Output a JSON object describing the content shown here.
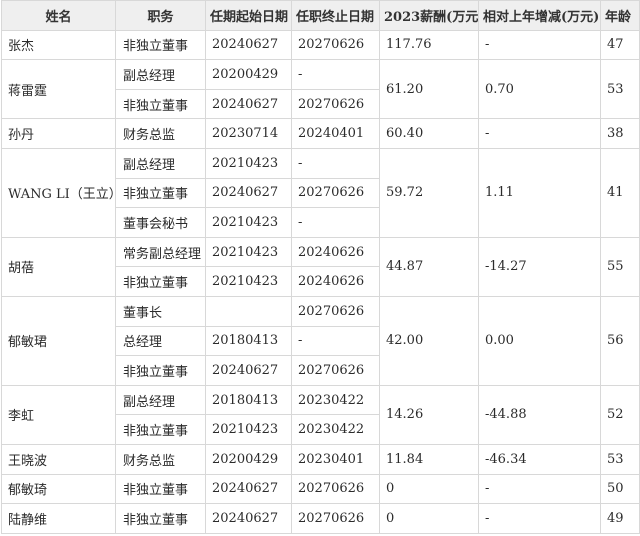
{
  "headers": [
    "姓名",
    "职务",
    "任期起始日期",
    "任职终止日期",
    "2023薪酬(万元)",
    "相对上年增减(万元)",
    "年龄"
  ],
  "people": [
    {
      "name": "张杰",
      "pay": "117.76",
      "change": "-",
      "age": "47",
      "roles": [
        {
          "title": "非独立董事",
          "start": "20240627",
          "end": "20270626"
        }
      ]
    },
    {
      "name": "蒋雷霆",
      "pay": "61.20",
      "change": "0.70",
      "age": "53",
      "roles": [
        {
          "title": "副总经理",
          "start": "20200429",
          "end": "-"
        },
        {
          "title": "非独立董事",
          "start": "20240627",
          "end": "20270626"
        }
      ]
    },
    {
      "name": "孙丹",
      "pay": "60.40",
      "change": "-",
      "age": "38",
      "roles": [
        {
          "title": "财务总监",
          "start": "20230714",
          "end": "20240401"
        }
      ]
    },
    {
      "name": "WANG LI（王立）",
      "pay": "59.72",
      "change": "1.11",
      "age": "41",
      "roles": [
        {
          "title": "副总经理",
          "start": "20210423",
          "end": "-"
        },
        {
          "title": "非独立董事",
          "start": "20240627",
          "end": "20270626"
        },
        {
          "title": "董事会秘书",
          "start": "20210423",
          "end": "-"
        }
      ]
    },
    {
      "name": "胡蓓",
      "pay": "44.87",
      "change": "-14.27",
      "age": "55",
      "roles": [
        {
          "title": "常务副总经理",
          "start": "20210423",
          "end": "20240626"
        },
        {
          "title": "非独立董事",
          "start": "20210423",
          "end": "20240626"
        }
      ]
    },
    {
      "name": "郁敏珺",
      "pay": "42.00",
      "change": "0.00",
      "age": "56",
      "roles": [
        {
          "title": "董事长",
          "start": "",
          "end": "20270626"
        },
        {
          "title": "总经理",
          "start": "20180413",
          "end": "-"
        },
        {
          "title": "非独立董事",
          "start": "20240627",
          "end": "20270626"
        }
      ]
    },
    {
      "name": "李虹",
      "pay": "14.26",
      "change": "-44.88",
      "age": "52",
      "roles": [
        {
          "title": "副总经理",
          "start": "20180413",
          "end": "20230422"
        },
        {
          "title": "非独立董事",
          "start": "20210423",
          "end": "20230422"
        }
      ]
    },
    {
      "name": "王晓波",
      "pay": "11.84",
      "change": "-46.34",
      "age": "53",
      "roles": [
        {
          "title": "财务总监",
          "start": "20200429",
          "end": "20230401"
        }
      ]
    },
    {
      "name": "郁敏琦",
      "pay": "0",
      "change": "-",
      "age": "50",
      "roles": [
        {
          "title": "非独立董事",
          "start": "20240627",
          "end": "20270626"
        }
      ]
    },
    {
      "name": "陆静维",
      "pay": "0",
      "change": "-",
      "age": "49",
      "roles": [
        {
          "title": "非独立董事",
          "start": "20240627",
          "end": "20270626"
        }
      ]
    }
  ]
}
